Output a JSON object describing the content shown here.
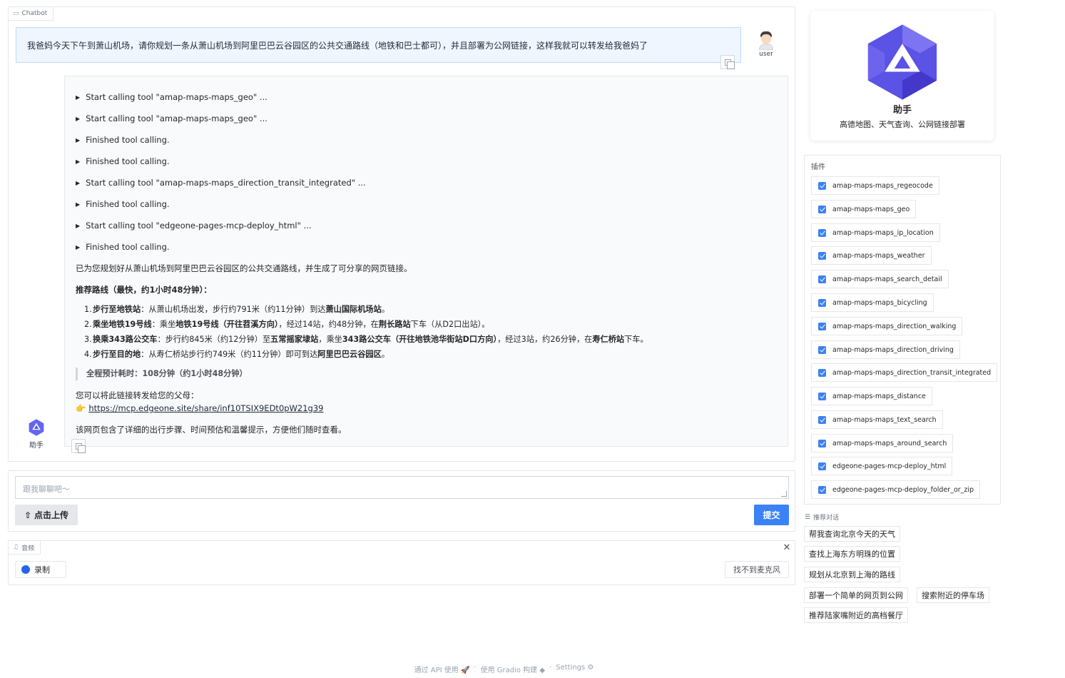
{
  "chatbot": {
    "label": "Chatbot",
    "user_message": "我爸妈今天下午到萧山机场，请你规划一条从萧山机场到阿里巴巴云谷园区的公共交通路线（地铁和巴士都可），并且部署为公网链接，这样我就可以转发给我爸妈了",
    "user_name": "user",
    "bot_name": "助手",
    "tool_calls": [
      "Start calling tool \"amap-maps-maps_geo\" ...",
      "Start calling tool \"amap-maps-maps_geo\" ...",
      "Finished tool calling.",
      "Finished tool calling.",
      "Start calling tool \"amap-maps-maps_direction_transit_integrated\" ...",
      "Finished tool calling.",
      "Start calling tool \"edgeone-pages-mcp-deploy_html\" ...",
      "Finished tool calling."
    ],
    "intro": "已为您规划好从萧山机场到阿里巴巴云谷园区的公共交通路线，并生成了可分享的网页链接。",
    "route_title": "推荐路线（最快，约1小时48分钟）：",
    "steps": [
      {
        "num": "1.",
        "head": "步行至地铁站",
        "body": "：从萧山机场出发，步行约791米（约11分钟）到达",
        "bold_end": "萧山国际机场站",
        "tail": "。"
      },
      {
        "num": "2.",
        "head": "乘坐地铁19号线",
        "body": "：乘坐",
        "mid_bold": "地铁19号线（开往苕溪方向）",
        "body2": "，经过14站，约48分钟，在",
        "bold_end": "荆长路站",
        "tail": "下车（从D2口出站）。"
      },
      {
        "num": "3.",
        "head": "换乘343路公交车",
        "body": "：步行约845米（约12分钟）至",
        "mid_bold": "五常摇家埭站",
        "body2": "，乘坐",
        "bold_2": "343路公交车（开往地铁池华街站D口方向）",
        "body3": "，经过3站，约26分钟，在",
        "bold_end": "寿仁桥站",
        "tail": "下车。"
      },
      {
        "num": "4.",
        "head": "步行至目的地",
        "body": "：从寿仁桥站步行约749米（约11分钟）即可到达",
        "bold_end": "阿里巴巴云谷园区",
        "tail": "。"
      }
    ],
    "total_time": "全程预计耗时：108分钟（约1小时48分钟）",
    "share_intro": "您可以将此链接转发给您的父母：",
    "share_link": "https://mcp.edgeone.site/share/inf10TSIX9EDt0pW21g39",
    "closing": "该网页包含了详细的出行步骤、时间预估和温馨提示，方便他们随时查看。"
  },
  "input": {
    "placeholder": "跟我聊聊吧～",
    "upload_label": "点击上传",
    "submit_label": "提交"
  },
  "audio": {
    "label": "音频",
    "record_label": "录制",
    "mic_label": "找不到麦克风"
  },
  "agent": {
    "name": "助手",
    "description": "高德地图、天气查询、公网链接部署"
  },
  "plugins": {
    "title": "插件",
    "items": [
      "amap-maps-maps_regeocode",
      "amap-maps-maps_geo",
      "amap-maps-maps_ip_location",
      "amap-maps-maps_weather",
      "amap-maps-maps_search_detail",
      "amap-maps-maps_bicycling",
      "amap-maps-maps_direction_walking",
      "amap-maps-maps_direction_driving",
      "amap-maps-maps_direction_transit_integrated",
      "amap-maps-maps_distance",
      "amap-maps-maps_text_search",
      "amap-maps-maps_around_search",
      "edgeone-pages-mcp-deploy_html",
      "edgeone-pages-mcp-deploy_folder_or_zip"
    ]
  },
  "suggestions": {
    "title": "推荐对话",
    "items": [
      "帮我查询北京今天的天气",
      "查找上海东方明珠的位置",
      "规划从北京到上海的路线",
      "部署一个简单的网页到公网",
      "搜索附近的停车场",
      "推荐陆家嘴附近的高档餐厅"
    ]
  },
  "footer": {
    "api": "通过 API 使用",
    "built": "使用 Gradio 构建",
    "settings": "Settings",
    "sep": "·"
  },
  "colors": {
    "accent": "#3b82f6",
    "logo_dark": "#4f46e5",
    "logo_light": "#818cf8"
  }
}
